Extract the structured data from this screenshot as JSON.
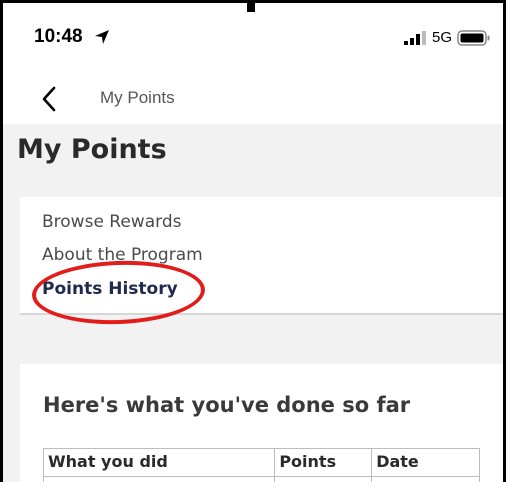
{
  "status_bar": {
    "time": "10:48",
    "location_icon": "location-arrow-icon",
    "signal_icon": "signal-bars-icon",
    "network": "5G",
    "battery_icon": "battery-icon"
  },
  "nav": {
    "back_icon": "chevron-left-icon",
    "title": "My Points"
  },
  "page": {
    "title": "My Points"
  },
  "menu": {
    "items": [
      {
        "label": "Browse Rewards"
      },
      {
        "label": "About the Program"
      },
      {
        "label": "Points History",
        "selected": true
      }
    ]
  },
  "annotation": {
    "color": "#e21b1b"
  },
  "history": {
    "title": "Here's what you've done so far",
    "columns": [
      "What you did",
      "Points",
      "Date"
    ]
  }
}
